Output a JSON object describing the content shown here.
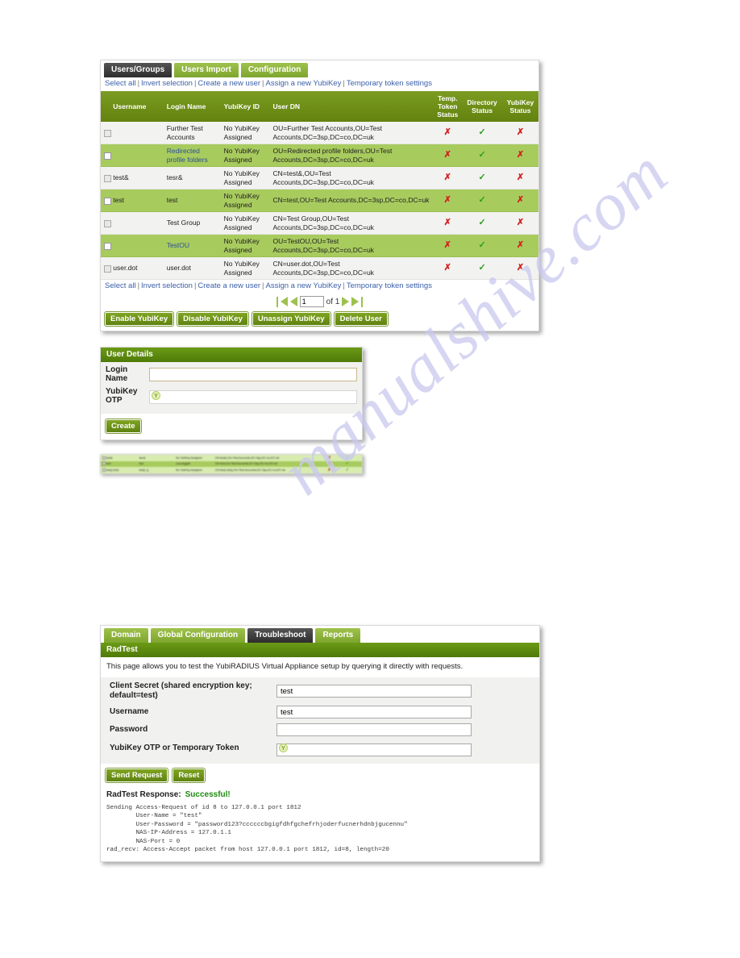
{
  "watermark": {
    "text": "manualshive.com"
  },
  "users_panel": {
    "tabs": [
      {
        "label": "Users/Groups",
        "active": true
      },
      {
        "label": "Users Import",
        "active": false
      },
      {
        "label": "Configuration",
        "active": false
      }
    ],
    "action_links": [
      "Select all",
      "Invert selection",
      "Create a new user",
      "Assign a new YubiKey",
      "Temporary token settings"
    ],
    "columns": [
      "",
      "Username",
      "Login Name",
      "YubiKey ID",
      "User DN",
      "Temp. Token Status",
      "Directory Status",
      "YubiKey Status"
    ],
    "rows": [
      {
        "checkbox_state": "dim",
        "username": "",
        "login_name": "Further Test Accounts",
        "login_is_link": true,
        "yubikey_id": "No YubiKey Assigned",
        "user_dn": "OU=Further Test Accounts,OU=Test Accounts,DC=3sp,DC=co,DC=uk",
        "temp_token_status": "x",
        "directory_status": "check",
        "yubikey_status": "x"
      },
      {
        "checkbox_state": "normal",
        "username": "",
        "login_name": "Redirected profile folders",
        "login_is_link": true,
        "yubikey_id": "No YubiKey Assigned",
        "user_dn": "OU=Redirected profile folders,OU=Test Accounts,DC=3sp,DC=co,DC=uk",
        "temp_token_status": "x",
        "directory_status": "check",
        "yubikey_status": "x"
      },
      {
        "checkbox_state": "dim",
        "username": "test&",
        "login_name": "tesr&",
        "login_is_link": false,
        "yubikey_id": "No YubiKey Assigned",
        "user_dn": "CN=test&,OU=Test Accounts,DC=3sp,DC=co,DC=uk",
        "temp_token_status": "x",
        "directory_status": "check",
        "yubikey_status": "x"
      },
      {
        "checkbox_state": "normal",
        "username": "test",
        "login_name": "test",
        "login_is_link": false,
        "yubikey_id": "No YubiKey Assigned",
        "user_dn": "CN=test,OU=Test Accounts,DC=3sp,DC=co,DC=uk",
        "temp_token_status": "x",
        "directory_status": "check",
        "yubikey_status": "x"
      },
      {
        "checkbox_state": "dim",
        "username": "",
        "login_name": "Test Group",
        "login_is_link": true,
        "yubikey_id": "No YubiKey Assigned",
        "user_dn": "CN=Test Group,OU=Test Accounts,DC=3sp,DC=co,DC=uk",
        "temp_token_status": "x",
        "directory_status": "check",
        "yubikey_status": "x"
      },
      {
        "checkbox_state": "normal",
        "username": "",
        "login_name": "TestOU",
        "login_is_link": true,
        "yubikey_id": "No YubiKey Assigned",
        "user_dn": "OU=TestOU,OU=Test Accounts,DC=3sp,DC=co,DC=uk",
        "temp_token_status": "x",
        "directory_status": "check",
        "yubikey_status": "x"
      },
      {
        "checkbox_state": "dim",
        "username": "user.dot",
        "login_name": "user.dot",
        "login_is_link": false,
        "yubikey_id": "No YubiKey Assigned",
        "user_dn": "CN=user.dot,OU=Test Accounts,DC=3sp,DC=co,DC=uk",
        "temp_token_status": "x",
        "directory_status": "check",
        "yubikey_status": "x"
      }
    ],
    "pager": {
      "current_page": "1",
      "of_label": "of 1"
    },
    "buttons": [
      "Enable YubiKey",
      "Disable YubiKey",
      "Unassign YubiKey",
      "Delete User"
    ]
  },
  "user_details_panel": {
    "title": "User Details",
    "login_name_label": "Login Name",
    "login_name_value": "",
    "login_name_placeholder": "",
    "yubikey_otp_label": "YubiKey OTP",
    "yubikey_otp_value": "",
    "yubikey_otp_icon": "yubikey-y-icon",
    "create_button": "Create"
  },
  "small_table": {
    "rows": [
      {
        "shade": "l",
        "username": "test&",
        "login_name": "tesr&",
        "yubikey_id": "No YubiKey Assigned",
        "user_dn": "CN=test&,OU=Test Accounts,DC=3sp,DC=co,DC=uk",
        "temp_token_status": "x",
        "directory_status": "check"
      },
      {
        "shade": "g",
        "username": "test",
        "login_name": "test",
        "yubikey_id": "cccccbgigfd",
        "user_dn": "CN=test,OU=Test Accounts,DC=3sp,DC=co,DC=uk",
        "temp_token_status": "x",
        "directory_status": "check"
      },
      {
        "shade": "l",
        "username": "test() test)",
        "login_name": "test() ;()",
        "yubikey_id": "No YubiKey Assigned",
        "user_dn": "CN=test( test(),OU=Test Accounts,DC=3sp,DC=co,DC=uk",
        "temp_token_status": "x",
        "directory_status": "check"
      }
    ]
  },
  "radtest_panel": {
    "tabs": [
      {
        "label": "Domain",
        "active": false
      },
      {
        "label": "Global Configuration",
        "active": false
      },
      {
        "label": "Troubleshoot",
        "active": true
      },
      {
        "label": "Reports",
        "active": false
      }
    ],
    "section_title": "RadTest",
    "description": "This page allows you to test the YubiRADIUS Virtual Appliance setup by querying it directly with requests.",
    "fields": [
      {
        "label": "Client Secret (shared encryption key; default=test)",
        "value": "test",
        "type": "text"
      },
      {
        "label": "Username",
        "value": "test",
        "type": "text"
      },
      {
        "label": "Password",
        "value": "",
        "type": "text"
      },
      {
        "label": "YubiKey OTP or Temporary Token",
        "value": "",
        "type": "otp",
        "icon": "yubikey-y-icon"
      }
    ],
    "buttons": [
      "Send Request",
      "Reset"
    ],
    "response_label": "RadTest Response:",
    "response_status": "Successful!",
    "log": "Sending Access-Request of id 8 to 127.0.0.1 port 1812\n        User-Name = \"test\"\n        User-Password = \"password123?ccccccbgigfdhfgchefrhjoderfucnerhdnbjgucennu\"\n        NAS-IP-Address = 127.0.1.1\n        NAS-Port = 0\nrad_recv: Access-Accept packet from host 127.0.0.1 port 1812, id=8, length=20"
  }
}
